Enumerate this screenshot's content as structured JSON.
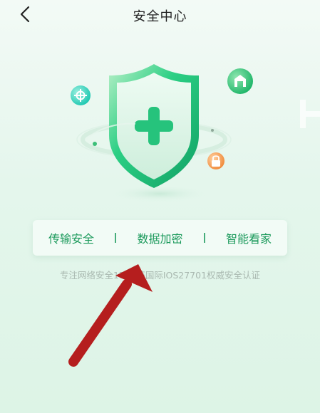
{
  "header": {
    "title": "安全中心",
    "back_icon": "chevron-left-icon"
  },
  "features": [
    {
      "label": "传输安全"
    },
    {
      "label": "数据加密"
    },
    {
      "label": "智能看家"
    }
  ],
  "certification": "专注网络安全17年  获国际IOS27701权威安全认证",
  "icons": {
    "shield": "shield-plus-icon",
    "home": "home-icon",
    "lock": "lock-icon",
    "target": "crosshair-icon",
    "annotation": "red-arrow-icon"
  },
  "colors": {
    "accent": "#1c9a5c",
    "shield": "#22c17a",
    "arrow": "#b51e1e",
    "lock": "#f39a4a"
  }
}
